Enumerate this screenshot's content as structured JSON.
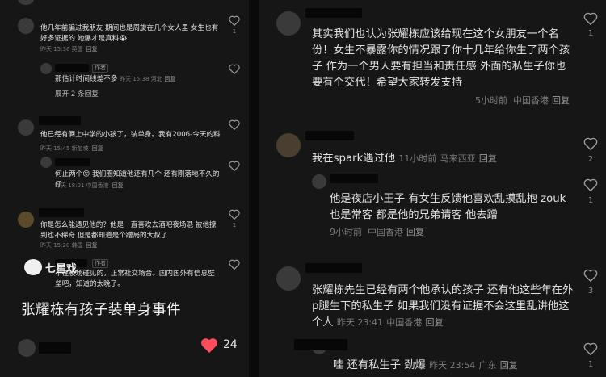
{
  "left": {
    "c1": {
      "text": "他几年前骗过我朋友 期间也是周旋在几个女人里 女生也有好多证据的 她爆才是真料😭",
      "meta": "昨天 15:36 英国",
      "reply": "回复",
      "likes": "1"
    },
    "r1": {
      "tag": "作者",
      "text": "那估计时间线差不多",
      "meta": "昨天 15:38 河北",
      "reply": "回复",
      "expand": "展开 2 条回复"
    },
    "c2": {
      "text": "他已经有俩上中学的小孩了，装单身。我有2006-今天的料",
      "meta": "昨天 15:45 新加坡",
      "reply": "回复"
    },
    "r2": {
      "text": "何止两个😮 我们圈知道他还有几个 还有刚落地不久的仔",
      "meta": "昨天 18:01 中国香港",
      "reply": "回复"
    },
    "c3": {
      "text": "你是怎么能遇见他的？他是一直喜欢去酒吧夜场混 被他撩到也不稀奇 但是都知道是个蹭局的大叔了",
      "meta": "昨天 15:20 韩国",
      "reply": "回复",
      "likes": "1"
    },
    "r3": {
      "tag": "作者",
      "text": "不在夜场碰见的，正常社交场合。国内国外有信息壁垒吧，知道的太晚了。",
      "meta": "",
      "reply": ""
    },
    "overlay_title": "张耀栋有孩子装单身事件",
    "watermark": "七星戏",
    "like_count": "24"
  },
  "right": {
    "c1": {
      "text": "其实我们也认为张耀栋应该给现在这个女朋友一个名份！女生不暴露你的情况跟了你十几年给你生了两个孩子 作为一个男人要有担当和责任感 外面的私生子你也要有个交代！希望大家转发支持",
      "time": "5小时前",
      "loc": "中国香港",
      "reply": "回复",
      "likes": "1"
    },
    "c2": {
      "text": "我在spark遇过他",
      "time": "11小时前",
      "loc": "马来西亚",
      "reply": "回复",
      "likes": "2"
    },
    "r2": {
      "text": "他是夜店小王子 有女生反馈他喜欢乱摸乱抱 zouk也是常客 都是他的兄弟请客 他去蹭",
      "time": "9小时前",
      "loc": "中国香港",
      "reply": "回复",
      "likes": "1"
    },
    "c3": {
      "text": "张耀栋先生已经有两个他承认的孩子 还有他这些年在外p腿生下的私生子 如果我们没有证据不会这里乱讲他这个人",
      "time": "昨天 23:41",
      "loc": "中国香港",
      "reply": "回复",
      "likes": "3"
    },
    "r3": {
      "text": "哇 还有私生子 劲爆",
      "time": "昨天 23:54",
      "loc": "广东",
      "reply": "回复",
      "likes": "1"
    }
  },
  "colors": {
    "background": "#161616",
    "text": "#e2e2e2",
    "meta": "#7a7a7a",
    "like_heart": "#ff4d5e"
  },
  "icons": [
    "heart-icon",
    "avatar"
  ]
}
